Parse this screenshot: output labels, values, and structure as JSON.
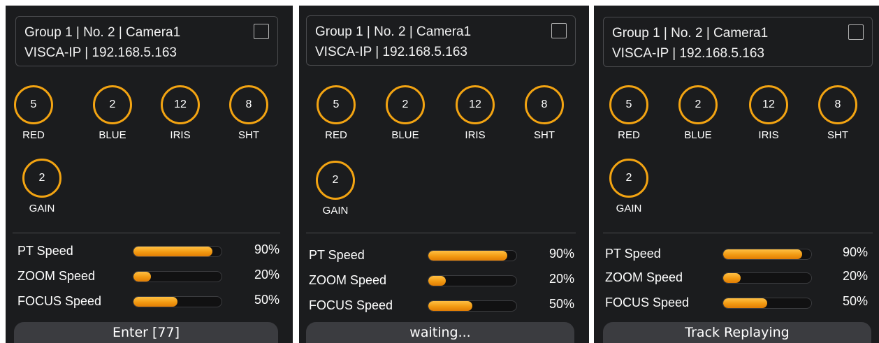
{
  "panels": [
    {
      "header": {
        "line1": "Group 1 | No. 2 | Camera1",
        "line2": "VISCA-IP | 192.168.5.163"
      },
      "knobs": [
        {
          "label": "RED",
          "value": "5"
        },
        {
          "label": "BLUE",
          "value": "2"
        },
        {
          "label": "IRIS",
          "value": "12"
        },
        {
          "label": "SHT",
          "value": "8"
        },
        {
          "label": "GAIN",
          "value": "2"
        }
      ],
      "speeds": [
        {
          "label": "PT Speed",
          "value": "90%",
          "fraction": 0.9
        },
        {
          "label": "ZOOM Speed",
          "value": "20%",
          "fraction": 0.2
        },
        {
          "label": "FOCUS Speed",
          "value": "50%",
          "fraction": 0.5
        }
      ],
      "status": "Enter [77]"
    },
    {
      "header": {
        "line1": "Group 1 | No. 2 | Camera1",
        "line2": "VISCA-IP | 192.168.5.163"
      },
      "knobs": [
        {
          "label": "RED",
          "value": "5"
        },
        {
          "label": "BLUE",
          "value": "2"
        },
        {
          "label": "IRIS",
          "value": "12"
        },
        {
          "label": "SHT",
          "value": "8"
        },
        {
          "label": "GAIN",
          "value": "2"
        }
      ],
      "speeds": [
        {
          "label": "PT Speed",
          "value": "90%",
          "fraction": 0.9
        },
        {
          "label": "ZOOM Speed",
          "value": "20%",
          "fraction": 0.2
        },
        {
          "label": "FOCUS Speed",
          "value": "50%",
          "fraction": 0.5
        }
      ],
      "status": "waiting..."
    },
    {
      "header": {
        "line1": "Group 1 | No. 2 | Camera1",
        "line2": "VISCA-IP | 192.168.5.163"
      },
      "knobs": [
        {
          "label": "RED",
          "value": "5"
        },
        {
          "label": "BLUE",
          "value": "2"
        },
        {
          "label": "IRIS",
          "value": "12"
        },
        {
          "label": "SHT",
          "value": "8"
        },
        {
          "label": "GAIN",
          "value": "2"
        }
      ],
      "speeds": [
        {
          "label": "PT Speed",
          "value": "90%",
          "fraction": 0.9
        },
        {
          "label": "ZOOM Speed",
          "value": "20%",
          "fraction": 0.2
        },
        {
          "label": "FOCUS Speed",
          "value": "50%",
          "fraction": 0.5
        }
      ],
      "status": "Track Replaying"
    }
  ],
  "colors": {
    "accent": "#f3a412",
    "panel_bg": "#1b1c1e",
    "status_bg": "#3b3c40"
  },
  "icons": {
    "select": "checkbox-icon"
  }
}
